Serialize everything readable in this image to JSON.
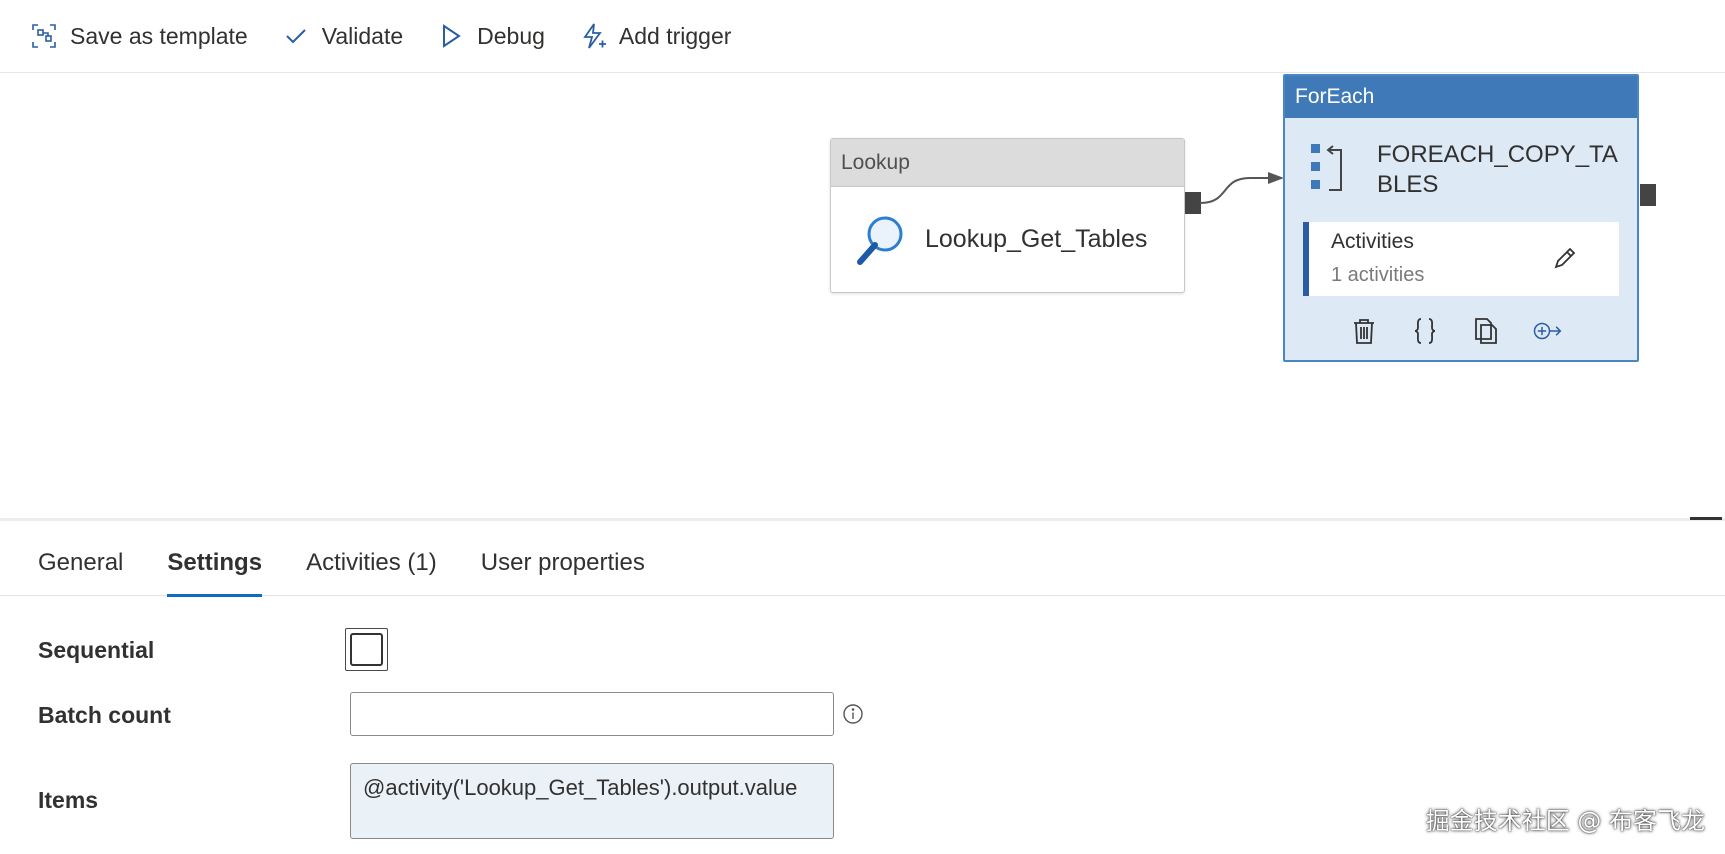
{
  "toolbar": {
    "save_template": "Save as template",
    "validate": "Validate",
    "debug": "Debug",
    "add_trigger": "Add trigger"
  },
  "canvas": {
    "lookup": {
      "type_label": "Lookup",
      "name": "Lookup_Get_Tables"
    },
    "foreach": {
      "type_label": "ForEach",
      "name": "FOREACH_COPY_TABLES",
      "activities_title": "Activities",
      "activities_count": "1 activities"
    }
  },
  "tabs": [
    {
      "label": "General",
      "active": false
    },
    {
      "label": "Settings",
      "active": true
    },
    {
      "label": "Activities (1)",
      "active": false
    },
    {
      "label": "User properties",
      "active": false
    }
  ],
  "form": {
    "sequential_label": "Sequential",
    "sequential_checked": false,
    "batch_count_label": "Batch count",
    "batch_count_value": "",
    "items_label": "Items",
    "items_value": "@activity('Lookup_Get_Tables').output.value"
  },
  "watermark": "掘金技术社区 @ 布客飞龙",
  "colors": {
    "accent": "#0f6cbd",
    "foreach_header": "#3f79b8",
    "foreach_body": "#dde9f5",
    "lookup_header": "#dcdcdc",
    "items_background": "#eaf1f7"
  }
}
